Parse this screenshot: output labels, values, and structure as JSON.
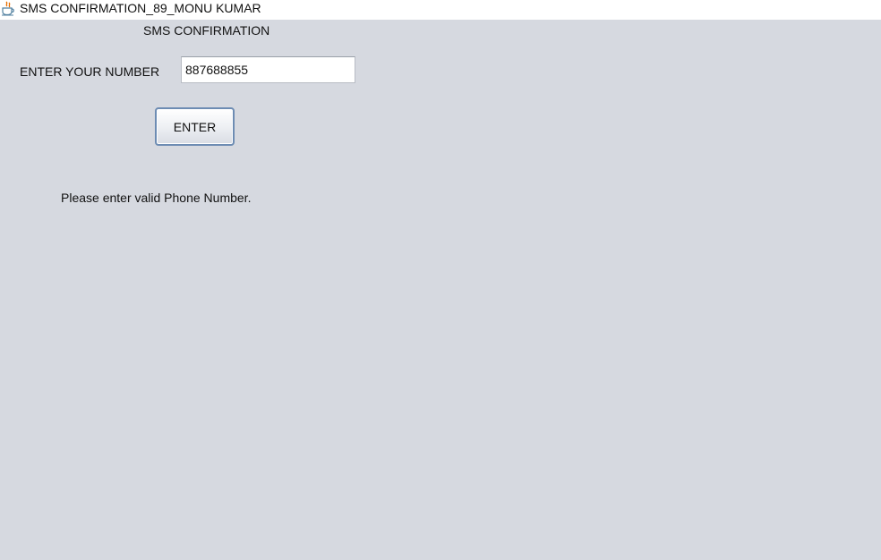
{
  "window": {
    "title": "SMS CONFIRMATION_89_MONU KUMAR",
    "icon": "java-coffee-cup-icon",
    "background_color": "#d6d9e0"
  },
  "form": {
    "heading": "SMS CONFIRMATION",
    "number_label": "ENTER YOUR NUMBER",
    "number_value": "887688855",
    "enter_button_label": "ENTER",
    "status_message": "Please enter valid Phone Number."
  },
  "colors": {
    "button_border": "#6d8cb3",
    "java_icon_orange": "#e76f00",
    "java_icon_blue": "#5382a1"
  }
}
